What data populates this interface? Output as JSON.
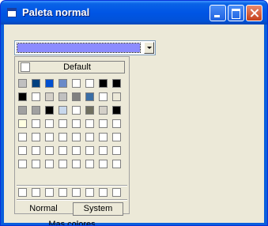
{
  "window": {
    "title": "Paleta normal"
  },
  "combo": {
    "selected_color": "#8c8cff"
  },
  "palette": {
    "default_label": "Default",
    "default_color": "#ffffff",
    "rows": [
      [
        "#c0c0c0",
        "#004080",
        "#0050d0",
        "#6a8ac8",
        "#ffffff",
        "#ffffff",
        "#000000",
        "#000000"
      ],
      [
        "#000000",
        "#ffffff",
        "#d4d0c8",
        "#c0c0c0",
        "#808080",
        "#3a6ea5",
        "#ffffff",
        "#ece9d8"
      ],
      [
        "#a0a0a0",
        "#a0a0a0",
        "#000000",
        "#c8d8ec",
        "#ffffff",
        "#707060",
        "#d4d0c8",
        "#000000"
      ],
      [
        "#ffffe1",
        "#ffffff",
        "#ffffff",
        "#ffffff",
        "#ffffff",
        "#ffffff",
        "#ffffff",
        "#ffffff"
      ],
      [
        "#ffffff",
        "#ffffff",
        "#ffffff",
        "#ffffff",
        "#ffffff",
        "#ffffff",
        "#ffffff",
        "#ffffff"
      ],
      [
        "#ffffff",
        "#ffffff",
        "#ffffff",
        "#ffffff",
        "#ffffff",
        "#ffffff",
        "#ffffff",
        "#ffffff"
      ],
      [
        "#ffffff",
        "#ffffff",
        "#ffffff",
        "#ffffff",
        "#ffffff",
        "#ffffff",
        "#ffffff",
        "#ffffff"
      ]
    ],
    "custom_row": [
      "#ffffff",
      "#ffffff",
      "#ffffff",
      "#ffffff",
      "#ffffff",
      "#ffffff",
      "#ffffff",
      "#ffffff"
    ],
    "normal_label": "Normal",
    "system_label": "System",
    "more_colors_label": "Mas colores"
  }
}
